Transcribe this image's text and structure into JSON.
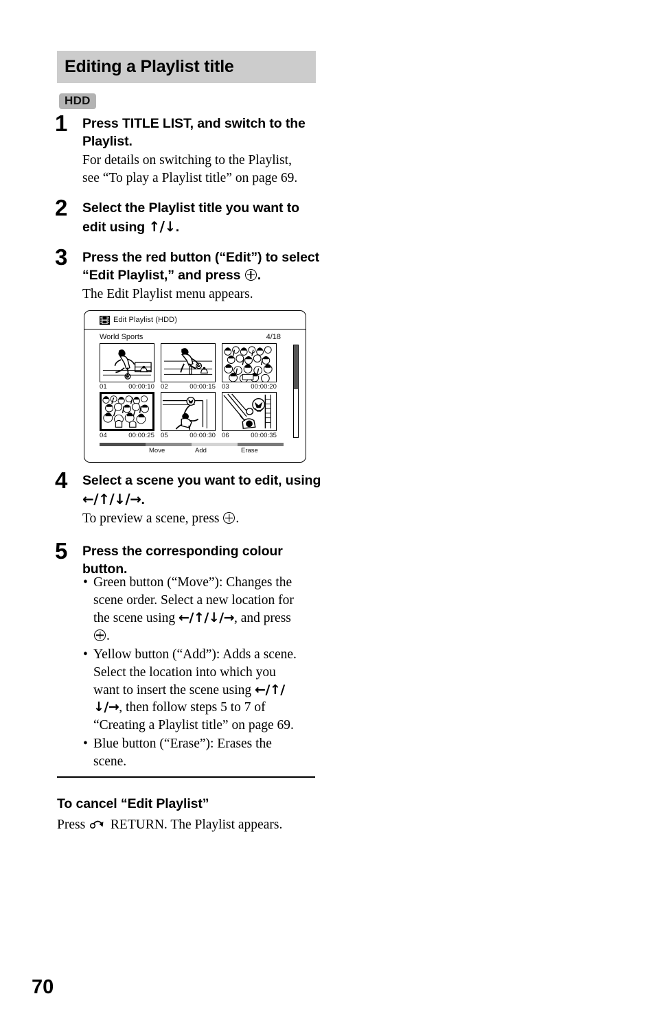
{
  "section": {
    "title": "Editing a Playlist title",
    "media_badge": "HDD",
    "title_band_color": "#cccccc",
    "badge_color": "#b3b3b3"
  },
  "steps": [
    {
      "number": "1",
      "heading_part1": "Press TITLE LIST, and switch to the",
      "heading_part2": "Playlist.",
      "body_line1": "For details on switching to the Playlist,",
      "body_line2": "see “To play a Playlist title” on page 69."
    },
    {
      "number": "2",
      "heading_part1": "Select the Playlist title you want to",
      "heading_part2_pre": "edit using ",
      "arrows": "↑/↓",
      "heading_part2_post": "."
    },
    {
      "number": "3",
      "heading_part1": "Press the red button (“Edit”) to select",
      "heading_part2_pre": "“Edit Playlist,” and press",
      "heading_part2_post": ".",
      "body_line1": "The Edit Playlist menu appears."
    },
    {
      "number": "4",
      "heading_part1": "Select a scene you want to edit, using",
      "arrows": "←/↑/↓/→",
      "heading_part2_post": ".",
      "body_pre": "To preview a scene, press",
      "body_post": "."
    },
    {
      "number": "5",
      "heading_part1": "Press the corresponding colour",
      "heading_part2": "button."
    }
  ],
  "screen": {
    "icon": "film-strip-icon",
    "title": "Edit Playlist (HDD)",
    "playlist_name": "World Sports",
    "counter": "4/18",
    "scenes": [
      {
        "number": "01",
        "time": "00:00:10",
        "art": "runner",
        "selected": false
      },
      {
        "number": "02",
        "time": "00:00:15",
        "art": "kicker",
        "selected": false
      },
      {
        "number": "03",
        "time": "00:00:20",
        "art": "crowd",
        "selected": false
      },
      {
        "number": "04",
        "time": "00:00:25",
        "art": "crowd",
        "selected": true
      },
      {
        "number": "05",
        "time": "00:00:30",
        "art": "goalkeeper",
        "selected": false
      },
      {
        "number": "06",
        "time": "00:00:35",
        "art": "goalnet",
        "selected": false
      }
    ],
    "colour_buttons": [
      {
        "label": "",
        "bar_color": "#4d4d4d"
      },
      {
        "label": "Move",
        "bar_color": "#8c8c8c"
      },
      {
        "label": "Add",
        "bar_color": "#d4d4d4"
      },
      {
        "label": "Erase",
        "bar_color": "#7a7a7a"
      }
    ]
  },
  "bullets": [
    {
      "line1": "Green button (“Move”): Changes the",
      "line2": "scene order. Select a new location for",
      "line3_pre": "the scene using ",
      "arrows": "←/↑/↓/→",
      "line3_post": ", and press",
      "line4_post": "."
    },
    {
      "line1": "Yellow button (“Add”): Adds a scene.",
      "line2": "Select the location into which you",
      "line3_pre": "want to insert the scene using ",
      "arrows_a": "←/↑/",
      "arrows_b": "↓/→",
      "line4_post": ", then follow steps 5 to 7 of",
      "line5": "“Creating a Playlist title” on page 69."
    },
    {
      "line1": "Blue button (“Erase”): Erases the",
      "line2": "scene."
    }
  ],
  "cancel_section": {
    "heading": "To cancel “Edit Playlist”",
    "body_pre": "Press",
    "body_post": "RETURN. The Playlist appears."
  },
  "folio": "70"
}
